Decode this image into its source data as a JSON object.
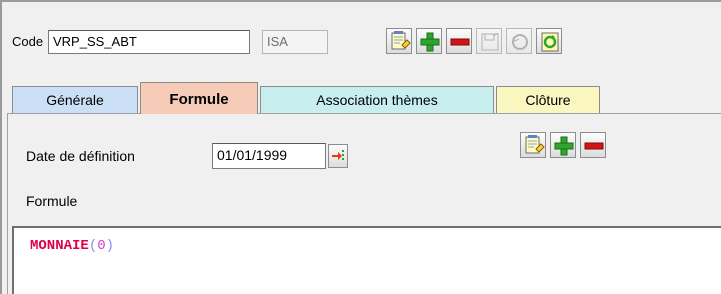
{
  "code_row": {
    "label": "Code",
    "code_value": "VRP_SS_ABT",
    "short_value": "ISA"
  },
  "toolbar": {
    "buttons": [
      {
        "name": "edit-record",
        "icon": "notepad-edit-icon",
        "enabled": true
      },
      {
        "name": "add-record",
        "icon": "plus-icon",
        "enabled": true
      },
      {
        "name": "delete-record",
        "icon": "minus-icon",
        "enabled": true
      },
      {
        "name": "save-record",
        "icon": "save-icon",
        "enabled": false
      },
      {
        "name": "undo-record",
        "icon": "undo-icon",
        "enabled": false
      },
      {
        "name": "refresh-record",
        "icon": "refresh-icon",
        "enabled": true
      }
    ]
  },
  "tabs": [
    {
      "label": "Générale",
      "color": "#cbe0f6",
      "active": false
    },
    {
      "label": "Formule",
      "color": "#f6cbb7",
      "active": true
    },
    {
      "label": "Association thèmes",
      "color": "#c8eef0",
      "active": false
    },
    {
      "label": "Clôture",
      "color": "#fbf7c0",
      "active": false
    }
  ],
  "formule_tab": {
    "date_label": "Date de définition",
    "date_value": "01/01/1999",
    "date_picker_icon": "calendar-arrow-icon",
    "formula_label": "Formule",
    "formula": {
      "function": "MONNAIE",
      "open_paren": "(",
      "argument": "0",
      "close_paren": ")"
    },
    "toolbar": [
      {
        "name": "edit-formula",
        "icon": "notepad-edit-icon"
      },
      {
        "name": "add-formula",
        "icon": "plus-icon"
      },
      {
        "name": "delete-formula",
        "icon": "minus-icon"
      }
    ]
  },
  "colors": {
    "formula_function": "#e0004a",
    "formula_paren": "#8a8aff",
    "formula_argument": "#d13ed1",
    "add_green": "#2fa52f",
    "delete_red": "#d41414"
  }
}
